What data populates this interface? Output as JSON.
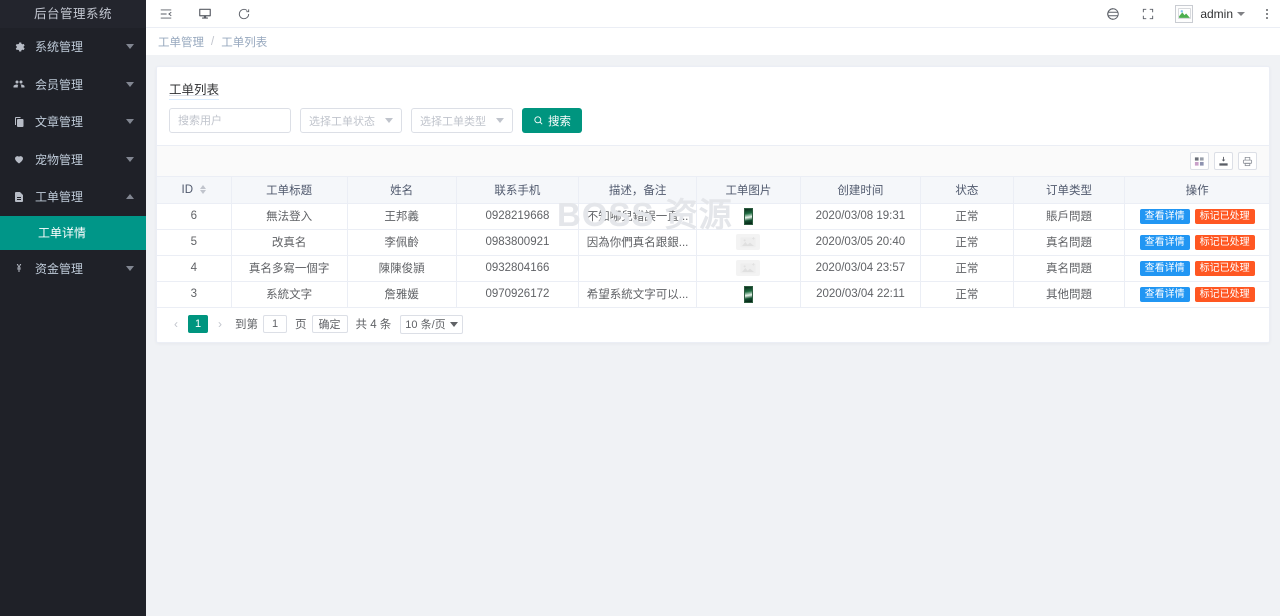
{
  "colors": {
    "sidebar_bg": "#1f2128",
    "accent_teal": "#009688",
    "search_button": "#00957f",
    "view_button": "#2196f3",
    "done_button": "#ff5722",
    "watermark": "#e4e6ea"
  },
  "sidebar": {
    "logo": "后台管理系统",
    "items": [
      {
        "label": "系统管理",
        "icon": "gear-icon",
        "expanded": false
      },
      {
        "label": "会员管理",
        "icon": "users-icon",
        "expanded": false
      },
      {
        "label": "文章管理",
        "icon": "document-icon",
        "expanded": false
      },
      {
        "label": "宠物管理",
        "icon": "heart-icon",
        "expanded": false
      },
      {
        "label": "工单管理",
        "icon": "file-icon",
        "expanded": true
      },
      {
        "label": "资金管理",
        "icon": "yen-icon",
        "expanded": false
      }
    ],
    "submenu": {
      "label": "工单详情",
      "active": true
    }
  },
  "topbar": {
    "left_icons": [
      "menu-collapse-icon",
      "screen-icon",
      "refresh-icon"
    ],
    "right_icons": [
      "theme-icon",
      "fullscreen-icon"
    ],
    "avatar": "avatar-image",
    "user": "admin",
    "more": "more-vertical-icon"
  },
  "breadcrumb": {
    "parent": "工单管理",
    "separator": "/",
    "current": "工单列表"
  },
  "card": {
    "title": "工单列表",
    "watermark": "BOSS 资源"
  },
  "search": {
    "user_placeholder": "搜索用户",
    "user_value": "",
    "status_placeholder": "选择工单状态",
    "type_placeholder": "选择工单类型",
    "button_label": "搜索",
    "button_icon": "search-icon"
  },
  "table_tools": [
    {
      "name": "columns-icon",
      "title": "列设置"
    },
    {
      "name": "export-icon",
      "title": "导出"
    },
    {
      "name": "print-icon",
      "title": "打印"
    }
  ],
  "table": {
    "columns": [
      "ID",
      "工单标题",
      "姓名",
      "联系手机",
      "描述，备注",
      "工单图片",
      "创建时间",
      "状态",
      "订单类型",
      "操作"
    ],
    "rows": [
      {
        "id": "6",
        "title": "無法登入",
        "name": "王邦義",
        "phone": "0928219668",
        "desc": "不知哪兒錯誤一直...",
        "image": "thumb",
        "created": "2020/03/08 19:31",
        "status": "正常",
        "type": "賬戶問題",
        "view": "查看详情",
        "done": "标记已处理"
      },
      {
        "id": "5",
        "title": "改真名",
        "name": "李佩齡",
        "phone": "0983800921",
        "desc": "因為你們真名跟銀...",
        "image": "broken",
        "created": "2020/03/05 20:40",
        "status": "正常",
        "type": "真名問題",
        "view": "查看详情",
        "done": "标记已处理"
      },
      {
        "id": "4",
        "title": "真名多寫一個字",
        "name": "陳陳俊頴",
        "phone": "0932804166",
        "desc": "",
        "image": "broken",
        "created": "2020/03/04 23:57",
        "status": "正常",
        "type": "真名問題",
        "view": "查看详情",
        "done": "标记已处理"
      },
      {
        "id": "3",
        "title": "系統文字",
        "name": "詹雅媛",
        "phone": "0970926172",
        "desc": "希望系統文字可以...",
        "image": "thumb",
        "created": "2020/03/04 22:11",
        "status": "正常",
        "type": "其他問題",
        "view": "查看详情",
        "done": "标记已处理"
      }
    ]
  },
  "pagination": {
    "prev": "‹",
    "next": "›",
    "current_page": "1",
    "goto_label": "到第",
    "goto_value": "1",
    "page_unit": "页",
    "confirm": "确定",
    "total_text": "共 4 条",
    "page_size": "10 条/页"
  }
}
